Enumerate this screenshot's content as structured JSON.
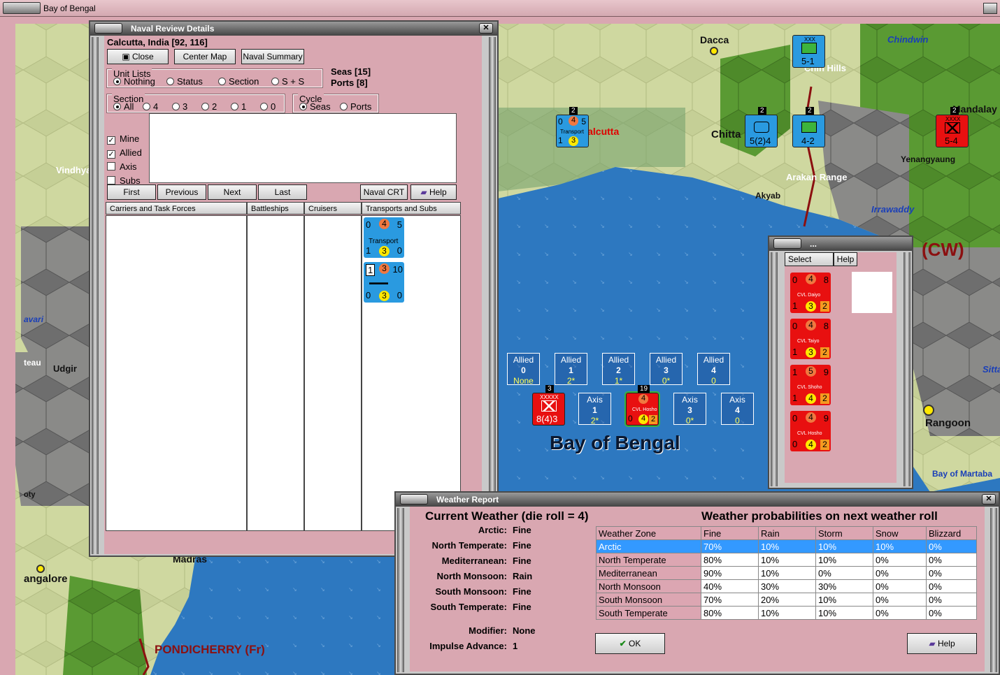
{
  "window_title": "Bay of Bengal",
  "map": {
    "labels": [
      "Dacca",
      "Chindwin",
      "Chin Hills",
      "Mandalay",
      "Calcutta",
      "Chitta",
      "Yenangyaung",
      "Arakan Range",
      "Akyab",
      "Irrawaddy",
      "(CW)",
      "Vindhya",
      "Udgir",
      "avari",
      "teau",
      "oty",
      "Madras",
      "angalore",
      "PONDICHERRY (Fr)",
      "Rangoon",
      "Bay of Martaba",
      "Sitta",
      "Bay of Bengal"
    ]
  },
  "naval_review": {
    "title": "Naval Review Details",
    "location": "Calcutta, India [92, 116]",
    "buttons": {
      "close": "Close",
      "center_map": "Center Map",
      "naval_summary": "Naval Summary"
    },
    "seas": "Seas [15]",
    "ports": "Ports [8]",
    "unit_lists": {
      "caption": "Unit Lists",
      "options": [
        "Nothing",
        "Status",
        "Section",
        "S + S"
      ],
      "selected": "Nothing"
    },
    "section": {
      "caption": "Section",
      "options": [
        "All",
        "4",
        "3",
        "2",
        "1",
        "0"
      ],
      "selected": "All"
    },
    "cycle": {
      "caption": "Cycle",
      "options": [
        "Seas",
        "Ports"
      ],
      "selected": "Seas"
    },
    "filters": [
      {
        "label": "Mine",
        "checked": true
      },
      {
        "label": "Allied",
        "checked": true
      },
      {
        "label": "Axis",
        "checked": false
      },
      {
        "label": "Subs",
        "checked": false
      }
    ],
    "nav": {
      "first": "First",
      "previous": "Previous",
      "next": "Next",
      "last": "Last",
      "crt": "Naval CRT",
      "help": "Help"
    },
    "columns": [
      "Carriers and Task Forces",
      "Battleships",
      "Cruisers",
      "Transports and Subs"
    ],
    "units": [
      {
        "top": [
          "0",
          "4",
          "5"
        ],
        "name": "Transport",
        "bottom": [
          "1",
          "3",
          "0"
        ]
      },
      {
        "top": [
          "1",
          "3",
          "10"
        ],
        "name": "",
        "bottom": [
          "0",
          "3",
          "0"
        ]
      }
    ]
  },
  "counters": {
    "calcutta": {
      "stack": "2",
      "top": [
        "0",
        "4",
        "5"
      ],
      "name": "Transport",
      "bottom": [
        "1",
        "3"
      ]
    },
    "chindwin": {
      "type": "XXX",
      "val": "5-1",
      "stack": ""
    },
    "chitta1": {
      "val": "5(2)4",
      "stack": "2"
    },
    "chitta2": {
      "val": "4-2",
      "stack": "2"
    },
    "mandalay": {
      "type": "XXXX",
      "val": "5-4",
      "stack": "2"
    },
    "sea_axis0": {
      "type": "XXXXX",
      "val": "8(4)3",
      "stack": "3"
    },
    "sea_axis2": {
      "name": "CVL Hosho",
      "top": "4",
      "bottom": [
        "0",
        "4",
        "2"
      ],
      "stack": "19"
    }
  },
  "sea_boxes": {
    "allied": [
      {
        "side": "Allied",
        "num": "0",
        "val": "None"
      },
      {
        "side": "Allied",
        "num": "1",
        "val": "2*"
      },
      {
        "side": "Allied",
        "num": "2",
        "val": "1*"
      },
      {
        "side": "Allied",
        "num": "3",
        "val": "0*"
      },
      {
        "side": "Allied",
        "num": "4",
        "val": "0"
      }
    ],
    "axis": [
      {
        "side": "Axis",
        "num": "1",
        "val": "2*"
      },
      {
        "side": "Axis",
        "num": "3",
        "val": "0*"
      },
      {
        "side": "Axis",
        "num": "4",
        "val": "0"
      }
    ]
  },
  "select_window": {
    "title": "...",
    "select": "Select",
    "help": "Help",
    "units": [
      {
        "top": [
          "0",
          "4",
          "8"
        ],
        "name": "CVL Daiyo",
        "bottom": [
          "1",
          "3",
          "2"
        ]
      },
      {
        "top": [
          "0",
          "4",
          "8"
        ],
        "name": "CVL Taiyo",
        "bottom": [
          "1",
          "3",
          "2"
        ]
      },
      {
        "top": [
          "1",
          "5",
          "9"
        ],
        "name": "CVL Shoho",
        "bottom": [
          "1",
          "4",
          "2"
        ]
      },
      {
        "top": [
          "0",
          "4",
          "9"
        ],
        "name": "CVL Hosho",
        "bottom": [
          "0",
          "4",
          "2"
        ]
      }
    ]
  },
  "weather": {
    "title": "Weather Report",
    "current_heading": "Current Weather (die roll = 4)",
    "prob_heading": "Weather probabilities on next weather roll",
    "current": [
      {
        "zone": "Arctic:",
        "value": "Fine"
      },
      {
        "zone": "North Temperate:",
        "value": "Fine"
      },
      {
        "zone": "Mediterranean:",
        "value": "Fine"
      },
      {
        "zone": "North Monsoon:",
        "value": "Rain"
      },
      {
        "zone": "South Monsoon:",
        "value": "Fine"
      },
      {
        "zone": "South Temperate:",
        "value": "Fine"
      }
    ],
    "modifier_label": "Modifier:",
    "modifier": "None",
    "impulse_label": "Impulse Advance:",
    "impulse": "1",
    "table_header": [
      "Weather Zone",
      "Fine",
      "Rain",
      "Storm",
      "Snow",
      "Blizzard"
    ],
    "table_rows": [
      [
        "Arctic",
        "70%",
        "10%",
        "10%",
        "10%",
        "0%"
      ],
      [
        "North Temperate",
        "80%",
        "10%",
        "10%",
        "0%",
        "0%"
      ],
      [
        "Mediterranean",
        "90%",
        "10%",
        "0%",
        "0%",
        "0%"
      ],
      [
        "North Monsoon",
        "40%",
        "30%",
        "30%",
        "0%",
        "0%"
      ],
      [
        "South Monsoon",
        "70%",
        "20%",
        "10%",
        "0%",
        "0%"
      ],
      [
        "South Temperate",
        "80%",
        "10%",
        "10%",
        "0%",
        "0%"
      ]
    ],
    "selected_row": 0,
    "ok": "OK",
    "help": "Help"
  }
}
